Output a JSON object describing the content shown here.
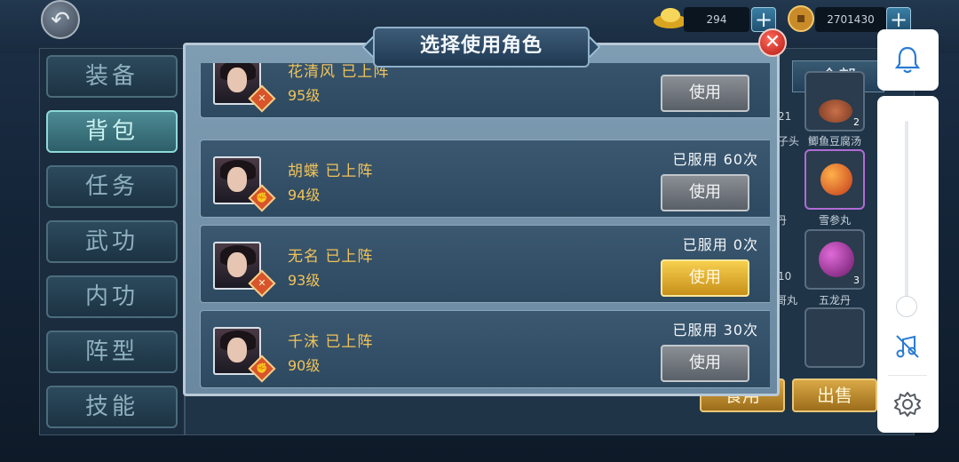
{
  "currencies": [
    {
      "icon": "gold-ingot-icon",
      "value": "294"
    },
    {
      "icon": "copper-coin-icon",
      "value": "2701430"
    }
  ],
  "nav": [
    {
      "label": "装备",
      "active": false
    },
    {
      "label": "背包",
      "active": true
    },
    {
      "label": "任务",
      "active": false
    },
    {
      "label": "武功",
      "active": false
    },
    {
      "label": "内功",
      "active": false
    },
    {
      "label": "阵型",
      "active": false
    },
    {
      "label": "技能",
      "active": false
    }
  ],
  "inventory": {
    "filter_tab": "全部",
    "items": [
      {
        "name": "",
        "count": "21"
      },
      {
        "name": "鲫鱼豆腐汤",
        "count": "2"
      },
      {
        "name": "雪参丸",
        "count": ""
      },
      {
        "name": "",
        "count": "10"
      },
      {
        "name": "五龙丹",
        "count": "3"
      }
    ],
    "partial_labels": [
      "子头",
      "丹",
      "哥丸"
    ],
    "buttons": {
      "use": "食用",
      "sell": "出售"
    }
  },
  "modal": {
    "title": "选择使用角色",
    "characters": [
      {
        "name": "花清风 已上阵",
        "level": "95级",
        "used": "",
        "button": "使用",
        "highlight": false,
        "badge": "sword"
      },
      {
        "name": "胡蝶 已上阵",
        "level": "94级",
        "used": "已服用 60次",
        "button": "使用",
        "highlight": false,
        "badge": "fist"
      },
      {
        "name": "无名 已上阵",
        "level": "93级",
        "used": "已服用 0次",
        "button": "使用",
        "highlight": true,
        "badge": "sword"
      },
      {
        "name": "千沫 已上阵",
        "level": "90级",
        "used": "已服用 30次",
        "button": "使用",
        "highlight": false,
        "badge": "fist"
      }
    ]
  },
  "system_overlay": {
    "icons": [
      "bell-icon",
      "music-off-icon",
      "gear-icon"
    ],
    "volume_level": 0.05,
    "accent": "#2a7bd5"
  }
}
